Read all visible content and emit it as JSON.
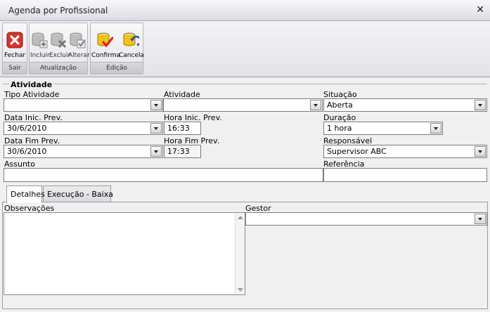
{
  "window": {
    "title": "Agenda por Profissional",
    "close_glyph": "✕"
  },
  "ribbon": {
    "groups": [
      {
        "caption": "Sair",
        "buttons": [
          {
            "label": "Fechar",
            "icon": "close-red-icon"
          }
        ]
      },
      {
        "caption": "Atualização",
        "buttons": [
          {
            "label": "Incluir",
            "icon": "database-add-icon"
          },
          {
            "label": "Excluir",
            "icon": "database-delete-icon"
          },
          {
            "label": "Alterar",
            "icon": "database-edit-icon"
          }
        ]
      },
      {
        "caption": "Edição",
        "buttons": [
          {
            "label": "Confirma",
            "icon": "confirm-icon"
          },
          {
            "label": "Cancela",
            "icon": "cancel-undo-icon"
          }
        ]
      }
    ]
  },
  "section": {
    "title": "Atividade"
  },
  "form": {
    "tipo_atividade": {
      "label": "Tipo Atividade",
      "value": ""
    },
    "atividade": {
      "label": "Atividade",
      "value": ""
    },
    "situacao": {
      "label": "Situação",
      "value": "Aberta"
    },
    "data_inic": {
      "label": "Data Inic. Prev.",
      "value": "30/6/2010"
    },
    "hora_inic": {
      "label": "Hora Inic. Prev.",
      "value": "16:33"
    },
    "duracao": {
      "label": "Duração",
      "value": "1 hora"
    },
    "data_fim": {
      "label": "Data Fim Prev.",
      "value": "30/6/2010"
    },
    "hora_fim": {
      "label": "Hora Fim Prev.",
      "value": "17:33"
    },
    "responsavel": {
      "label": "Responsável",
      "value": "Supervisor ABC"
    },
    "assunto": {
      "label": "Assunto",
      "value": ""
    },
    "referencia": {
      "label": "Referência",
      "value": ""
    }
  },
  "tabs": [
    {
      "label": "Detalhes",
      "active": true
    },
    {
      "label": "Execução - Baixa",
      "active": false
    }
  ],
  "detalhes": {
    "observacoes": {
      "label": "Observações",
      "value": ""
    },
    "gestor": {
      "label": "Gestor",
      "value": ""
    }
  },
  "colors": {
    "close_red": "#d9322a",
    "db_yellow": "#f2c21c",
    "confirm_red": "#d42020"
  }
}
